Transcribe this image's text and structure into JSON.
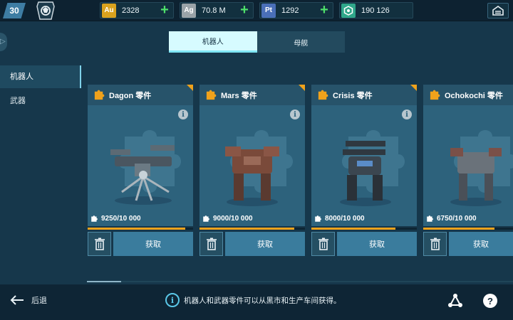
{
  "header": {
    "level": "30",
    "resources": [
      {
        "symbol": "Au",
        "value": "2328",
        "badge_color": "#d9a21e",
        "has_plus": true
      },
      {
        "symbol": "Ag",
        "value": "70.8 M",
        "badge_color": "#9aa3a8",
        "has_plus": true
      },
      {
        "symbol": "Pt",
        "value": "1292",
        "badge_color": "#4a6fb8",
        "has_plus": true
      },
      {
        "symbol": "",
        "value": "190 126",
        "badge_color": "#2fa78a",
        "has_plus": false
      }
    ]
  },
  "tabs": [
    {
      "label": "机器人",
      "active": true
    },
    {
      "label": "母舰",
      "active": false
    }
  ],
  "sidebar": {
    "items": [
      {
        "label": "机器人",
        "active": true
      },
      {
        "label": "武器",
        "active": false
      }
    ]
  },
  "cards": [
    {
      "name": "Dagon 零件",
      "progress_text": "9250/10 000",
      "progress": 0.925,
      "action": "获取"
    },
    {
      "name": "Mars 零件",
      "progress_text": "9000/10 000",
      "progress": 0.9,
      "action": "获取"
    },
    {
      "name": "Crisis 零件",
      "progress_text": "8000/10 000",
      "progress": 0.8,
      "action": "获取"
    },
    {
      "name": "Ochokochi 零件",
      "progress_text": "6750/10 000",
      "progress": 0.675,
      "action": "获取"
    }
  ],
  "footer": {
    "back_label": "后退",
    "hint": "机器人和武器零件可以从黑市和生产车间获得。",
    "help_symbol": "?",
    "info_symbol": "i"
  },
  "colors": {
    "accent": "#5ac8e8",
    "progress": "#f0a21b",
    "plus": "#4ee06a"
  }
}
